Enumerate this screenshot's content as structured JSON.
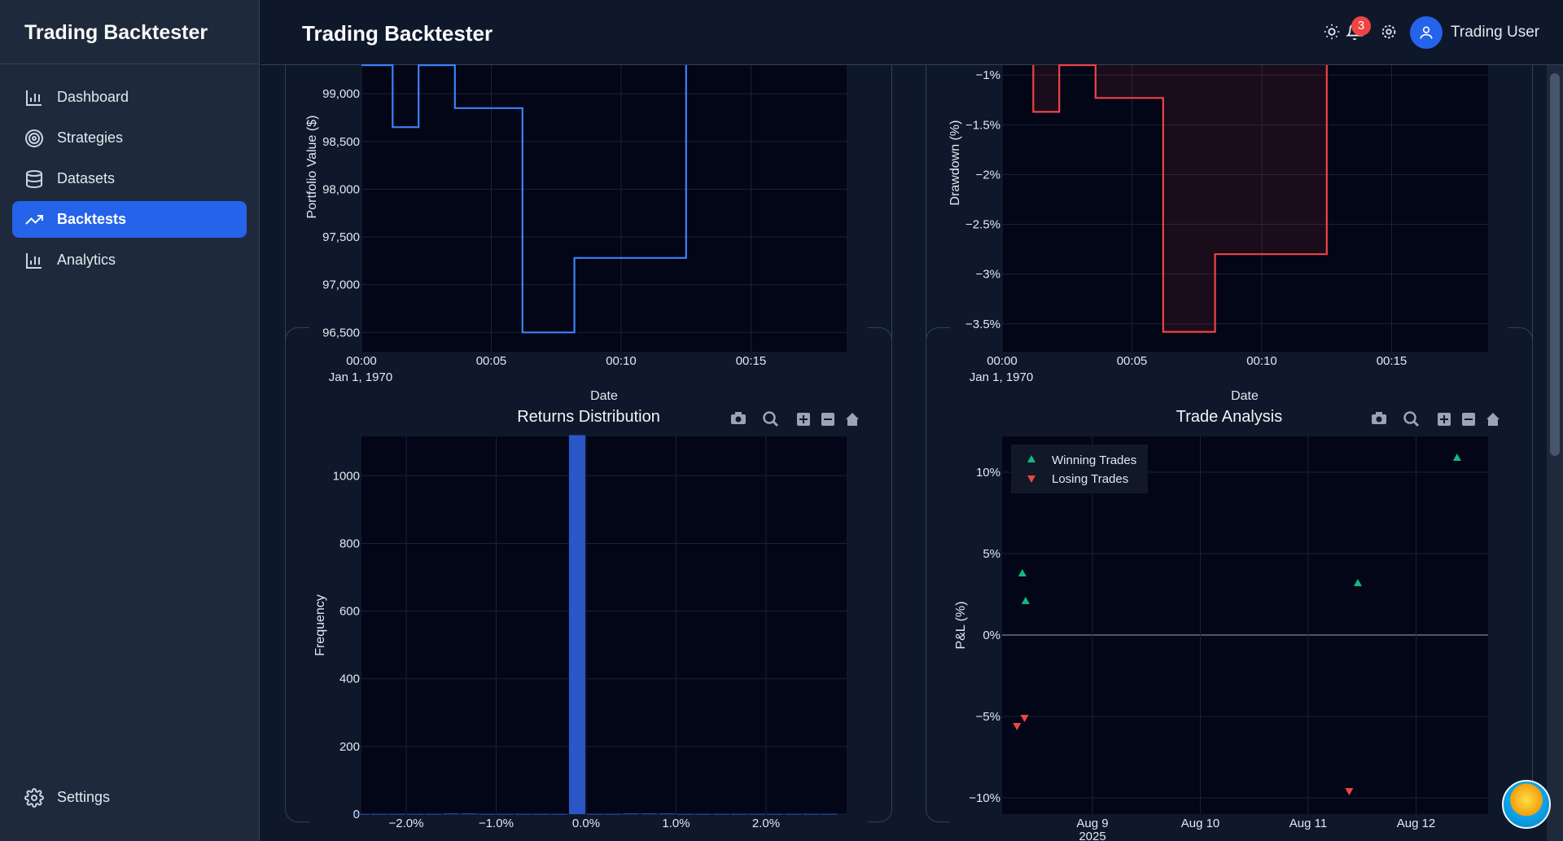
{
  "app": {
    "brand": "Trading Backtester",
    "header_title": "Trading Backtester",
    "notification_count": "3",
    "user_name": "Trading User"
  },
  "sidebar": {
    "items": [
      {
        "label": "Dashboard",
        "icon": "bar-chart-icon",
        "active": false
      },
      {
        "label": "Strategies",
        "icon": "target-icon",
        "active": false
      },
      {
        "label": "Datasets",
        "icon": "database-icon",
        "active": false
      },
      {
        "label": "Backtests",
        "icon": "trending-up-icon",
        "active": true
      },
      {
        "label": "Analytics",
        "icon": "bar-chart-icon",
        "active": false
      }
    ],
    "settings_label": "Settings"
  },
  "colors": {
    "accent": "#2563eb",
    "portfolio_line": "#3b82f6",
    "drawdown_line": "#ef4444",
    "win": "#10b981",
    "loss": "#ef4444",
    "plot_bg": "#030617"
  },
  "modebar_icons": [
    "camera-icon",
    "zoom-icon",
    "zoom-in-icon",
    "zoom-out-icon",
    "home-icon"
  ],
  "chart_data": [
    {
      "type": "line",
      "ylabel": "Portfolio Value ($)",
      "xlabel": "Date",
      "y_ticks": [
        "99,000",
        "98,500",
        "98,000",
        "97,500",
        "97,000",
        "96,500"
      ],
      "x_ticks": [
        "00:00",
        "00:05",
        "00:10",
        "00:15"
      ],
      "x_sublabel": "Jan 1, 1970",
      "x_minutes": [
        0,
        1.2,
        1.2,
        2.2,
        2.2,
        3.6,
        3.6,
        6.2,
        6.2,
        8.2,
        8.2,
        12.5,
        12.5
      ],
      "values": [
        99300,
        99300,
        98650,
        98650,
        99300,
        99300,
        98850,
        98850,
        96500,
        96500,
        97280,
        97280,
        99300
      ],
      "ylim": [
        96400,
        99300
      ]
    },
    {
      "type": "area",
      "ylabel": "Drawdown (%)",
      "xlabel": "Date",
      "y_ticks": [
        "−1%",
        "−1.5%",
        "−2%",
        "−2.5%",
        "−3%",
        "−3.5%"
      ],
      "x_ticks": [
        "00:00",
        "00:05",
        "00:10",
        "00:15"
      ],
      "x_sublabel": "Jan 1, 1970",
      "x_minutes": [
        1.2,
        1.2,
        2.2,
        2.2,
        3.6,
        3.6,
        6.2,
        6.2,
        8.2,
        8.2,
        12.5,
        12.5
      ],
      "values": [
        -0.9,
        -1.37,
        -1.37,
        -0.9,
        -0.9,
        -1.23,
        -1.23,
        -3.58,
        -3.58,
        -2.8,
        -2.8,
        -0.9
      ],
      "ylim": [
        -3.6,
        -0.9
      ]
    },
    {
      "type": "bar",
      "title": "Returns Distribution",
      "ylabel": "Frequency",
      "y_ticks": [
        "1000",
        "800",
        "600",
        "400",
        "200",
        "0"
      ],
      "x_ticks": [
        "−2.0%",
        "−1.0%",
        "0.0%",
        "1.0%",
        "2.0%"
      ],
      "bins_pct": [
        -2.5,
        -2.3,
        -2.1,
        -1.9,
        -1.7,
        -1.5,
        -1.3,
        -1.1,
        -0.9,
        -0.7,
        -0.5,
        -0.3,
        -0.1,
        0.1,
        0.3,
        0.5,
        0.7,
        0.9,
        1.1,
        1.3,
        1.5,
        1.7,
        1.9,
        2.1,
        2.3,
        2.5,
        2.7
      ],
      "counts": [
        1,
        1,
        1,
        1,
        1,
        2,
        2,
        1,
        1,
        1,
        1,
        1,
        1120,
        1,
        1,
        2,
        2,
        2,
        1,
        1,
        1,
        1,
        1,
        1,
        1,
        1,
        1
      ],
      "ylim": [
        0,
        1150
      ]
    },
    {
      "type": "scatter",
      "title": "Trade Analysis",
      "ylabel": "P&L (%)",
      "y_ticks": [
        "10%",
        "5%",
        "0%",
        "−5%",
        "−10%"
      ],
      "x_ticks": [
        "Aug 9",
        "Aug 10",
        "Aug 11",
        "Aug 12"
      ],
      "x_year": "2025",
      "legend": {
        "position": "top-left",
        "entries": [
          "Winning Trades",
          "Losing Trades"
        ]
      },
      "series": [
        {
          "name": "Winning Trades",
          "x_days": [
            8.35,
            8.38,
            11.46,
            12.38
          ],
          "values": [
            3.8,
            2.1,
            3.2,
            10.9
          ]
        },
        {
          "name": "Losing Trades",
          "x_days": [
            8.3,
            8.37,
            11.38
          ],
          "values": [
            -5.6,
            -5.1,
            -9.6
          ]
        }
      ],
      "ylim": [
        -11,
        12.2
      ]
    }
  ]
}
